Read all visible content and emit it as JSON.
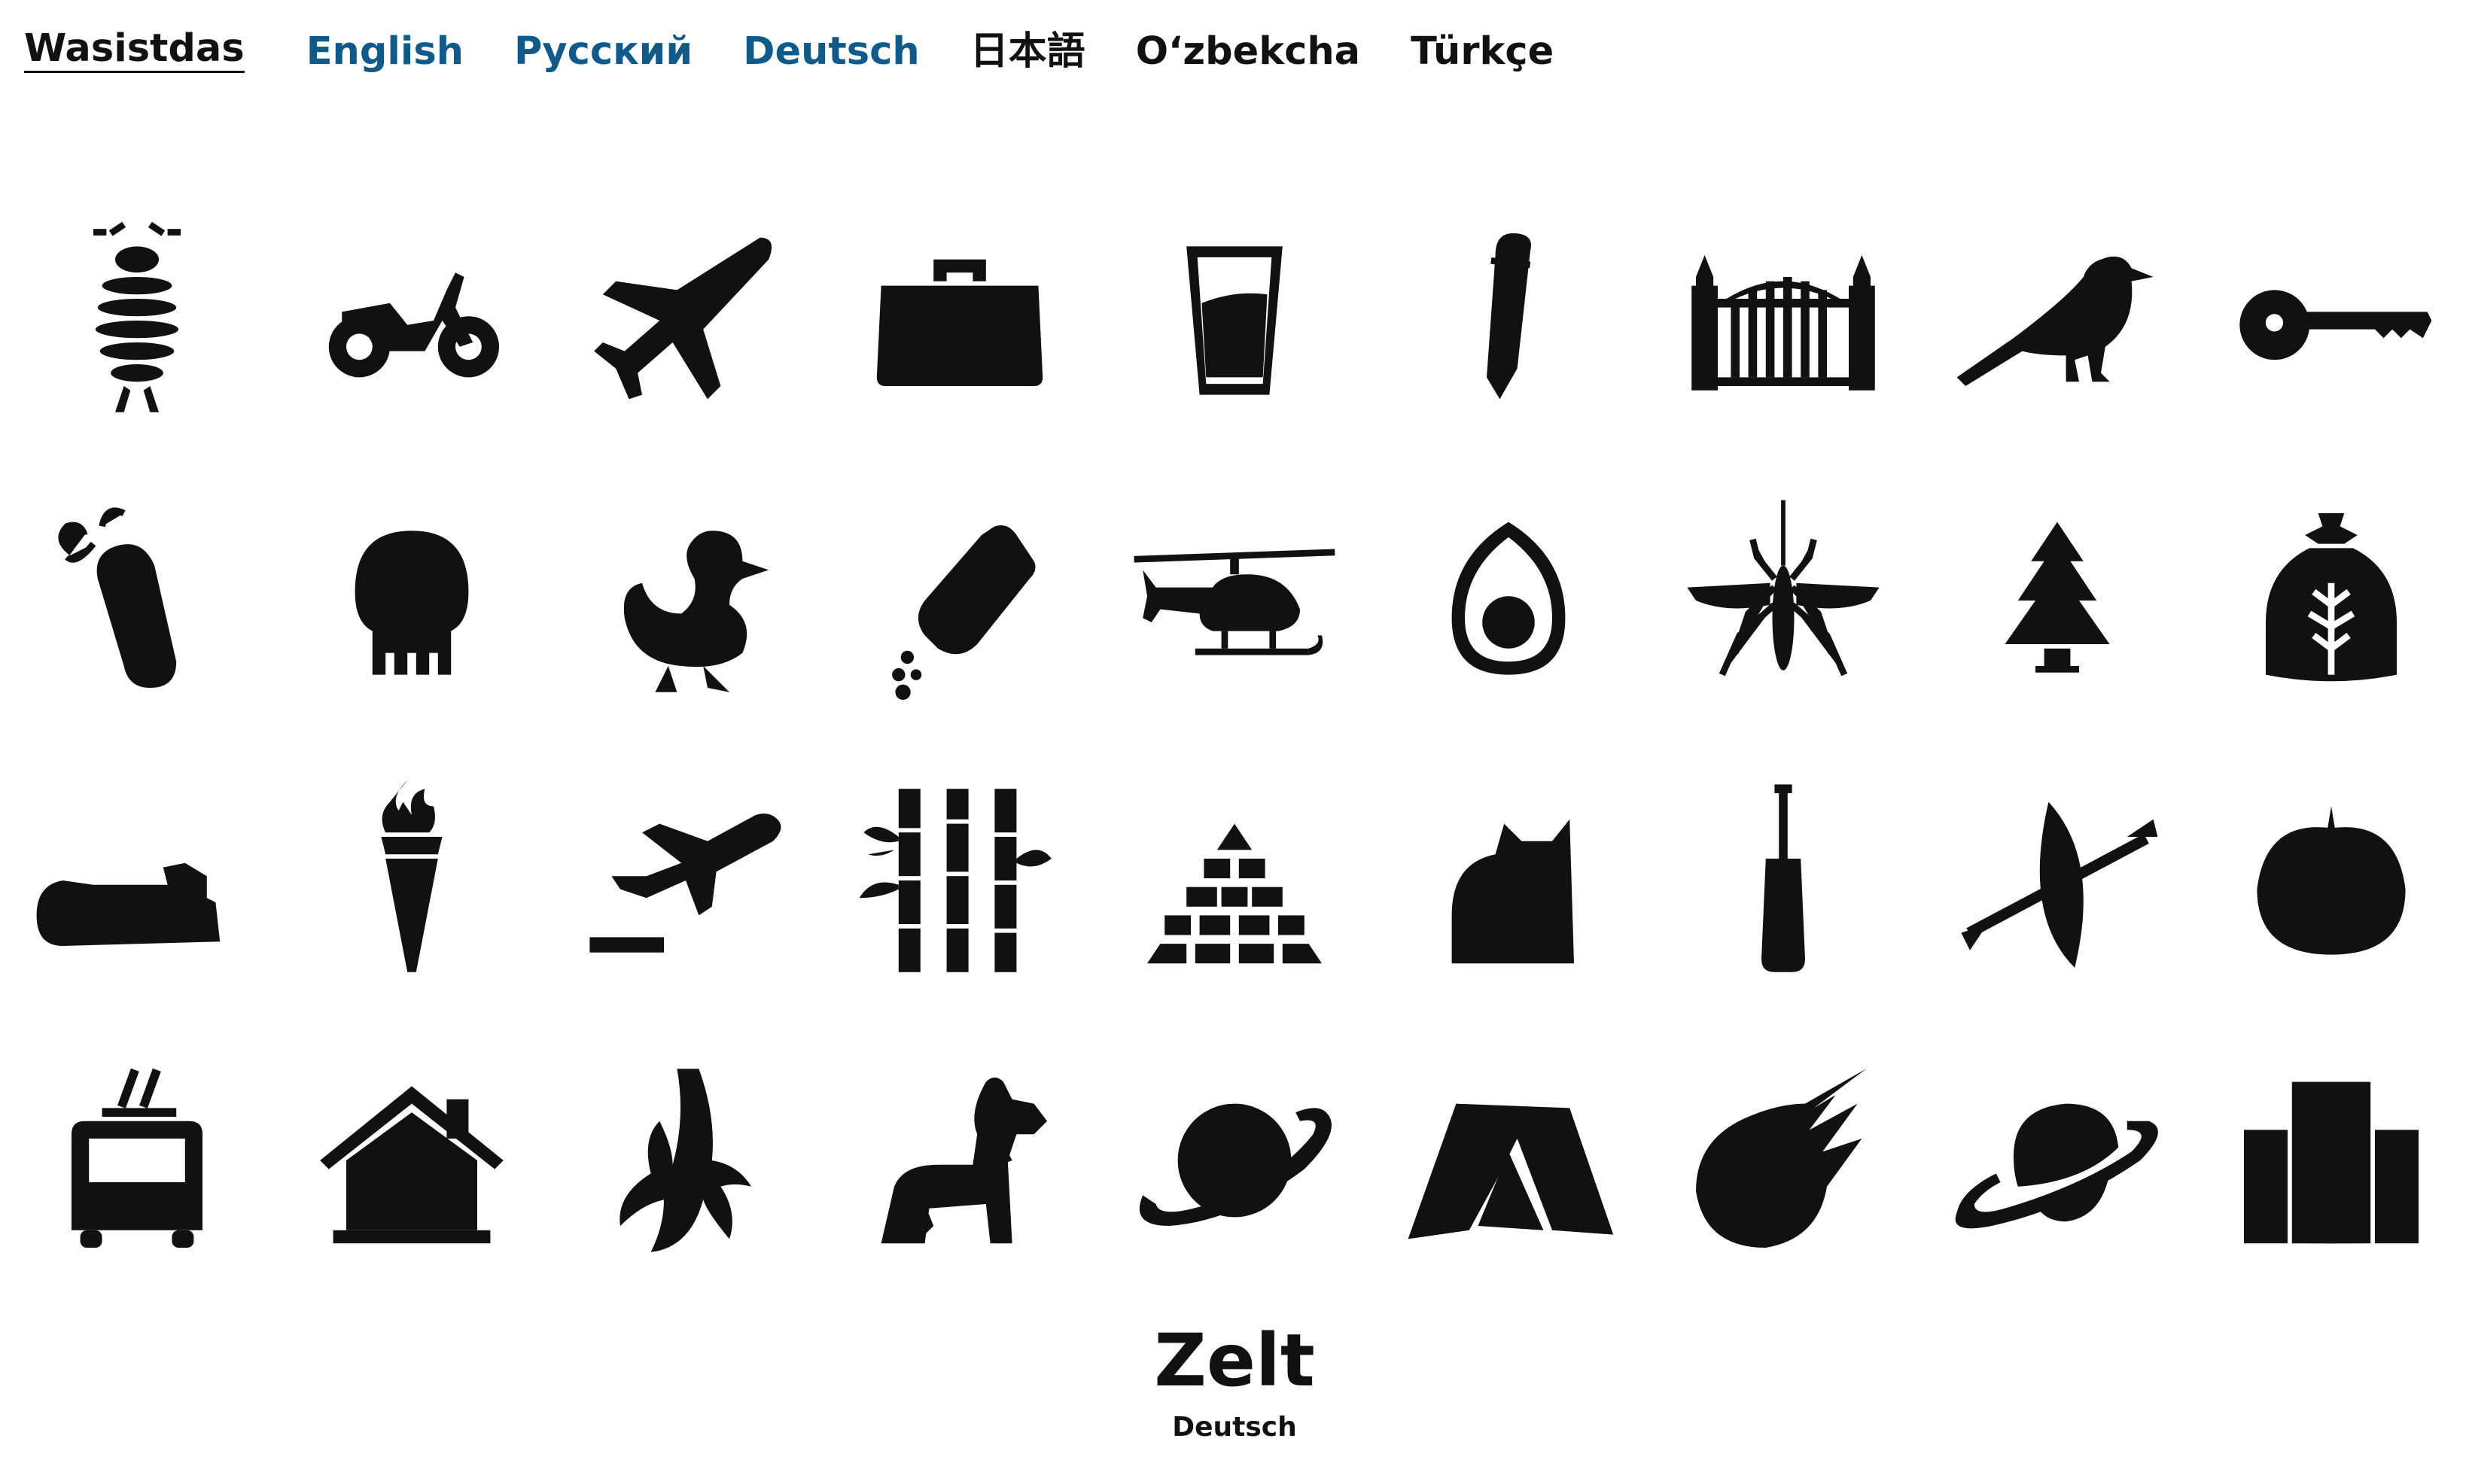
{
  "nav": {
    "brand": "Wasistdas",
    "languages": [
      "English",
      "Русский",
      "Deutsch",
      "日本語",
      "O‘zbekcha",
      "Türkçe"
    ]
  },
  "caption": {
    "word": "Zelt",
    "language": "Deutsch"
  },
  "colors": {
    "link": "#0e5a8a",
    "icon": "#111111",
    "background": "#ffffff"
  },
  "icons": [
    "woodlouse-icon",
    "motorcycle-icon",
    "airplane-icon",
    "briefcase-icon",
    "glass-icon",
    "pencil-icon",
    "gate-icon",
    "magpie-icon",
    "key-icon",
    "pickle-icon",
    "skull-icon",
    "duck-icon",
    "salt-shaker-icon",
    "helicopter-icon",
    "egg-icon",
    "mosquito-icon",
    "fir-tree-icon",
    "flour-sack-icon",
    "log-icon",
    "torch-icon",
    "departure-icon",
    "bamboo-icon",
    "pyramid-icon",
    "cat-icon",
    "screwdriver-icon",
    "kayak-icon",
    "tomato-icon",
    "trolleybus-icon",
    "house-icon",
    "banana-icon",
    "dog-icon",
    "planet-icon",
    "tent-icon",
    "meteor-icon",
    "saturn-icon",
    "hospital-icon"
  ]
}
